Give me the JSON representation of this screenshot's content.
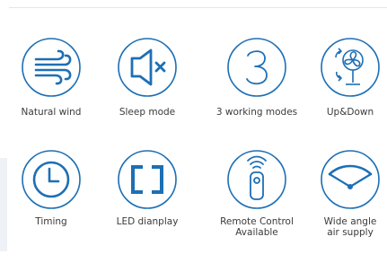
{
  "accent_color": "#1d6fb5",
  "features": [
    {
      "label": "Natural wind",
      "icon": "wind-icon"
    },
    {
      "label": "Sleep mode",
      "icon": "mute-speaker-icon"
    },
    {
      "label": "3 working modes",
      "icon": "number-3-icon"
    },
    {
      "label": "Up&Down",
      "icon": "rotating-fan-icon"
    },
    {
      "label": "Timing",
      "icon": "clock-icon"
    },
    {
      "label": "LED dianplay",
      "icon": "led-display-icon"
    },
    {
      "label": "Remote Control\nAvailable",
      "icon": "remote-control-icon"
    },
    {
      "label": "Wide angle\nair supply",
      "icon": "wide-angle-icon"
    }
  ]
}
